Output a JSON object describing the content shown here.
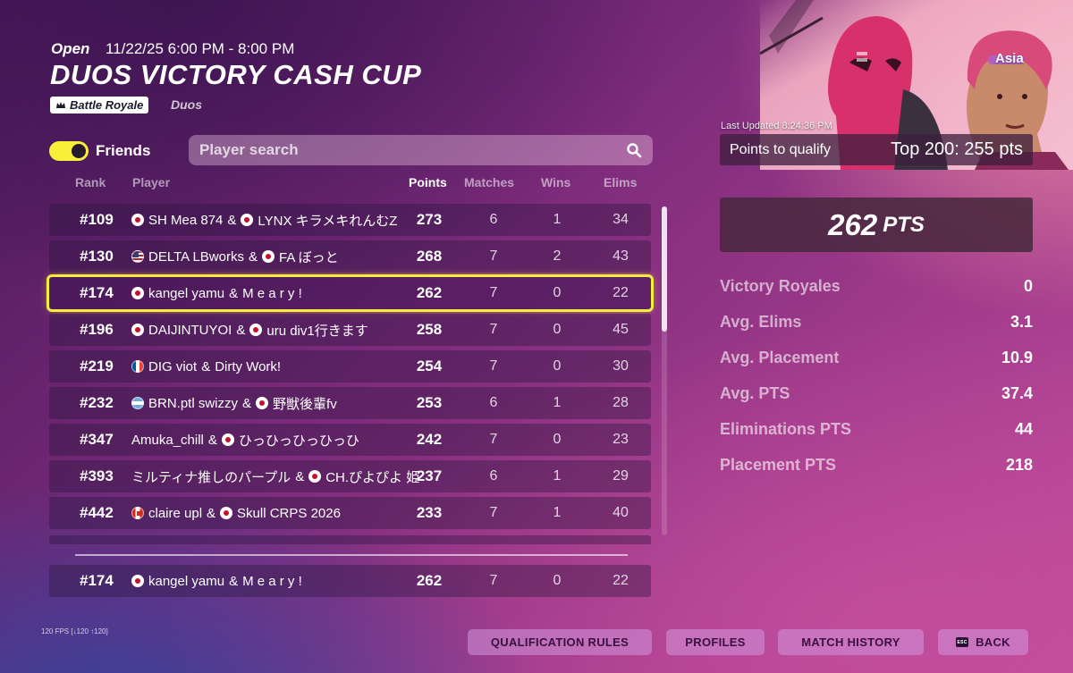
{
  "header": {
    "status": "Open",
    "time": "11/22/25 6:00 PM - 8:00 PM",
    "title": "DUOS VICTORY CASH CUP",
    "mode_badge": "Battle Royale",
    "mode_badge_icon": "crown-icon",
    "mode_sub": "Duos"
  },
  "filters": {
    "friends_label": "Friends",
    "friends_enabled": true,
    "search_placeholder": "Player search",
    "search_value": "",
    "search_icon": "magnifier-icon"
  },
  "table": {
    "columns": {
      "rank": "Rank",
      "player": "Player",
      "points": "Points",
      "matches": "Matches",
      "wins": "Wins",
      "elims": "Elims"
    },
    "rows": [
      {
        "rank": "#109",
        "p1_flag": "jp",
        "p1": "SH Mea 874",
        "sep": "&",
        "p2_flag": "jp",
        "p2": "LYNX キラメキれんむZ",
        "points": "273",
        "matches": "6",
        "wins": "1",
        "elims": "34",
        "highlight": false
      },
      {
        "rank": "#130",
        "p1_flag": "us",
        "p1": "DELTA LBworks",
        "sep": "&",
        "p2_flag": "jp",
        "p2": "FA ぼっと",
        "points": "268",
        "matches": "7",
        "wins": "2",
        "elims": "43",
        "highlight": false
      },
      {
        "rank": "#174",
        "p1_flag": "jp",
        "p1": "kangel yamu",
        "sep": "&",
        "p2_flag": "",
        "p2": "M e a r y !",
        "points": "262",
        "matches": "7",
        "wins": "0",
        "elims": "22",
        "highlight": true
      },
      {
        "rank": "#196",
        "p1_flag": "jp",
        "p1": "DAIJINTUYOI",
        "sep": "&",
        "p2_flag": "jp",
        "p2": "uru div1行きます",
        "points": "258",
        "matches": "7",
        "wins": "0",
        "elims": "45",
        "highlight": false
      },
      {
        "rank": "#219",
        "p1_flag": "fr",
        "p1": "DIG viot",
        "sep": "&",
        "p2_flag": "",
        "p2": "Dirty Work!",
        "points": "254",
        "matches": "7",
        "wins": "0",
        "elims": "30",
        "highlight": false
      },
      {
        "rank": "#232",
        "p1_flag": "ar",
        "p1": "BRN.ptl swizzy",
        "sep": "&",
        "p2_flag": "jp",
        "p2": "野獣後輩fv",
        "points": "253",
        "matches": "6",
        "wins": "1",
        "elims": "28",
        "highlight": false
      },
      {
        "rank": "#347",
        "p1_flag": "",
        "p1": "Amuka_chill",
        "sep": "&",
        "p2_flag": "jp",
        "p2": "ひっひっひっひっひ",
        "points": "242",
        "matches": "7",
        "wins": "0",
        "elims": "23",
        "highlight": false
      },
      {
        "rank": "#393",
        "p1_flag": "",
        "p1": "ミルティナ推しのパープル",
        "sep": "&",
        "p2_flag": "jp",
        "p2": "CH.ぴよぴよ 姫",
        "points": "237",
        "matches": "6",
        "wins": "1",
        "elims": "29",
        "highlight": false
      },
      {
        "rank": "#442",
        "p1_flag": "ca",
        "p1": "claire upl",
        "sep": "&",
        "p2_flag": "jp",
        "p2": "Skull CRPS 2026",
        "points": "233",
        "matches": "7",
        "wins": "1",
        "elims": "40",
        "highlight": false
      }
    ],
    "pinned": {
      "rank": "#174",
      "p1_flag": "jp",
      "p1": "kangel yamu",
      "sep": "&",
      "p2_flag": "",
      "p2": "M e a r y !",
      "points": "262",
      "matches": "7",
      "wins": "0",
      "elims": "22"
    }
  },
  "side": {
    "region": "Asia",
    "last_updated": "Last Updated 8:24:36 PM",
    "qualify_label": "Points to qualify",
    "qualify_value": "Top 200: 255 pts",
    "pts_value": "262",
    "pts_unit": "PTS",
    "stats": [
      {
        "label": "Victory Royales",
        "value": "0"
      },
      {
        "label": "Avg. Elims",
        "value": "3.1"
      },
      {
        "label": "Avg. Placement",
        "value": "10.9"
      },
      {
        "label": "Avg. PTS",
        "value": "37.4"
      },
      {
        "label": "Eliminations PTS",
        "value": "44"
      },
      {
        "label": "Placement PTS",
        "value": "218"
      }
    ]
  },
  "footer": {
    "fps": "120 FPS [↓120 ↑120]",
    "buttons": {
      "qualification_rules": "QUALIFICATION RULES",
      "profiles": "PROFILES",
      "match_history": "MATCH HISTORY",
      "back": "BACK",
      "back_key": "ESC"
    }
  },
  "colors": {
    "accent_yellow": "#f4ee3a",
    "panel_dark": "#3c1e3c"
  }
}
